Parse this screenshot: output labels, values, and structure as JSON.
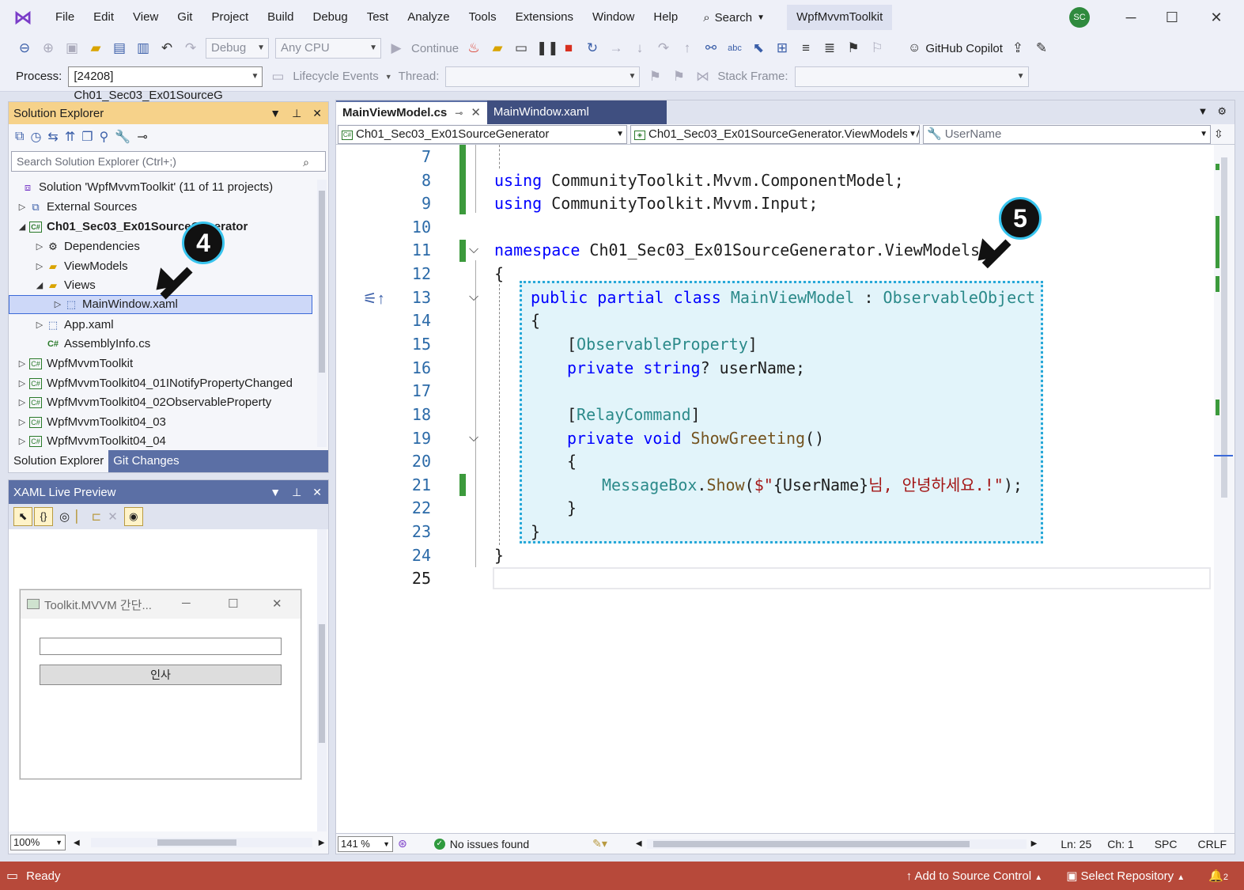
{
  "menu": {
    "items": [
      "File",
      "Edit",
      "View",
      "Git",
      "Project",
      "Build",
      "Debug",
      "Test",
      "Analyze",
      "Tools",
      "Extensions",
      "Window",
      "Help"
    ],
    "search_label": "Search",
    "solution_name": "WpfMvvmToolkit",
    "avatar_initials": "SC",
    "minimize": "─",
    "maximize": "☐",
    "close": "✕"
  },
  "toolbar": {
    "config": "Debug",
    "platform": "Any CPU",
    "continue_label": "Continue",
    "copilot_label": "GitHub Copilot"
  },
  "debug_toolbar": {
    "process_label": "Process:",
    "process_value": "[24208] Ch01_Sec03_Ex01SourceG",
    "lifecycle_label": "Lifecycle Events",
    "thread_label": "Thread:",
    "stack_label": "Stack Frame:"
  },
  "solution_explorer": {
    "title": "Solution Explorer",
    "search_placeholder": "Search Solution Explorer (Ctrl+;)",
    "items": [
      {
        "label": "Solution 'WpfMvvmToolkit' (11 of 11 projects)",
        "icon": "solution-icon"
      },
      {
        "label": "External Sources",
        "icon": "external-sources-icon"
      },
      {
        "label": "Ch01_Sec03_Ex01SourceGenerator",
        "icon": "csharp-project-icon"
      },
      {
        "label": "Dependencies",
        "icon": "dependencies-icon"
      },
      {
        "label": "ViewModels",
        "icon": "folder-icon"
      },
      {
        "label": "Views",
        "icon": "folder-icon"
      },
      {
        "label": "MainWindow.xaml",
        "icon": "xaml-file-icon"
      },
      {
        "label": "App.xaml",
        "icon": "xaml-file-icon"
      },
      {
        "label": "AssemblyInfo.cs",
        "icon": "csharp-file-icon"
      },
      {
        "label": "WpfMvvmToolkit",
        "icon": "csharp-project-icon"
      },
      {
        "label": "WpfMvvmToolkit04_01INotifyPropertyChanged",
        "icon": "csharp-project-icon"
      },
      {
        "label": "WpfMvvmToolkit04_02ObservableProperty",
        "icon": "csharp-project-icon"
      },
      {
        "label": "WpfMvvmToolkit04_03",
        "icon": "csharp-project-icon"
      },
      {
        "label": "WpfMvvmToolkit04_04",
        "icon": "csharp-project-icon"
      }
    ],
    "tabs": [
      "Solution Explorer",
      "Git Changes"
    ]
  },
  "xaml_preview": {
    "title": "XAML Live Preview",
    "window_title": "Toolkit.MVVM 간단...",
    "button_label": "인사",
    "zoom": "100%"
  },
  "editor": {
    "tabs": [
      "MainViewModel.cs",
      "MainWindow.xaml"
    ],
    "nav_project": "Ch01_Sec03_Ex01SourceGenerator",
    "nav_type": "Ch01_Sec03_Ex01SourceGenerator.ViewModels.M",
    "nav_member": "UserName",
    "line_numbers": [
      "7",
      "8",
      "9",
      "10",
      "11",
      "12",
      "13",
      "14",
      "15",
      "16",
      "17",
      "18",
      "19",
      "20",
      "21",
      "22",
      "23",
      "24",
      "25"
    ],
    "code": {
      "l8_kw": "using",
      "l8_rest": " CommunityToolkit.Mvvm.ComponentModel;",
      "l9_kw": "using",
      "l9_rest": " CommunityToolkit.Mvvm.Input;",
      "l11_kw": "namespace",
      "l11_rest": " Ch01_Sec03_Ex01SourceGenerator.ViewModels",
      "l12": "{",
      "l13_kw": "public partial class",
      "l13_name": " MainViewModel",
      "l13_sep": " : ",
      "l13_base": "ObservableObject",
      "l14": "{",
      "l15_open": "[",
      "l15_attr": "ObservableProperty",
      "l15_close": "]",
      "l16_kw": "private string",
      "l16_rest": "? userName;",
      "l18_open": "[",
      "l18_attr": "RelayCommand",
      "l18_close": "]",
      "l19_kw": "private void",
      "l19_meth": " ShowGreeting",
      "l19_rest": "()",
      "l20": "{",
      "l21_cls": "MessageBox",
      "l21_dot": ".",
      "l21_meth": "Show",
      "l21_open": "(",
      "l21_str1": "$\"",
      "l21_interp": "{UserName}",
      "l21_str2": "님, 안녕하세요.!\"",
      "l21_close": ");",
      "l22": "}",
      "l23": "}",
      "l24": "}"
    },
    "zoom": "141 %",
    "issues": "No issues found",
    "ln": "Ln: 25",
    "ch": "Ch: 1",
    "spc": "SPC",
    "eol": "CRLF"
  },
  "callouts": [
    "4",
    "5"
  ],
  "statusbar": {
    "ready": "Ready",
    "source_control": "Add to Source Control",
    "repository": "Select Repository",
    "notifications": "2"
  }
}
